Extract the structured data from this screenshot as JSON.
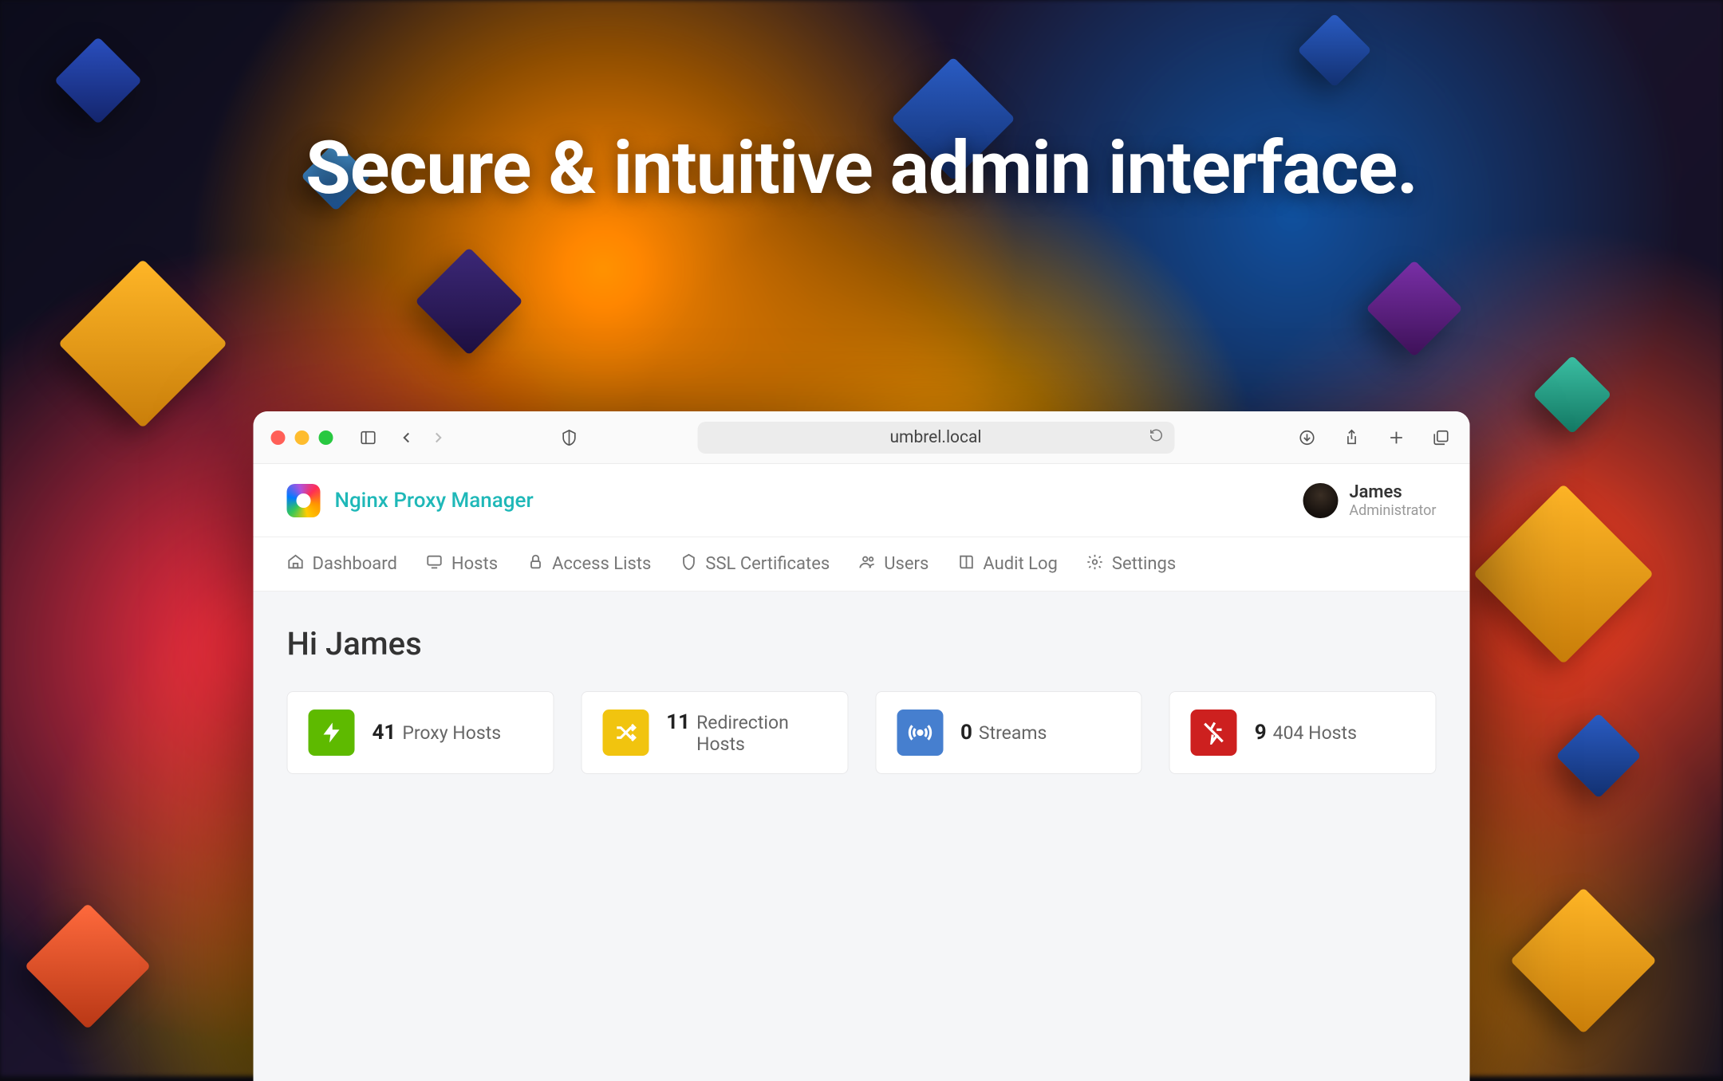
{
  "hero_headline": "Secure & intuitive admin interface.",
  "browser": {
    "url": "umbrel.local"
  },
  "app": {
    "brand_name": "Nginx Proxy Manager",
    "user": {
      "name": "James",
      "role": "Administrator"
    },
    "nav": {
      "dashboard": "Dashboard",
      "hosts": "Hosts",
      "access_lists": "Access Lists",
      "ssl": "SSL Certificates",
      "users": "Users",
      "audit_log": "Audit Log",
      "settings": "Settings"
    },
    "greeting": "Hi James",
    "cards": [
      {
        "count": "41",
        "label": "Proxy Hosts",
        "color": "green"
      },
      {
        "count": "11",
        "label": "Redirection Hosts",
        "color": "yellow"
      },
      {
        "count": "0",
        "label": "Streams",
        "color": "blue"
      },
      {
        "count": "9",
        "label": "404 Hosts",
        "color": "red"
      }
    ]
  }
}
